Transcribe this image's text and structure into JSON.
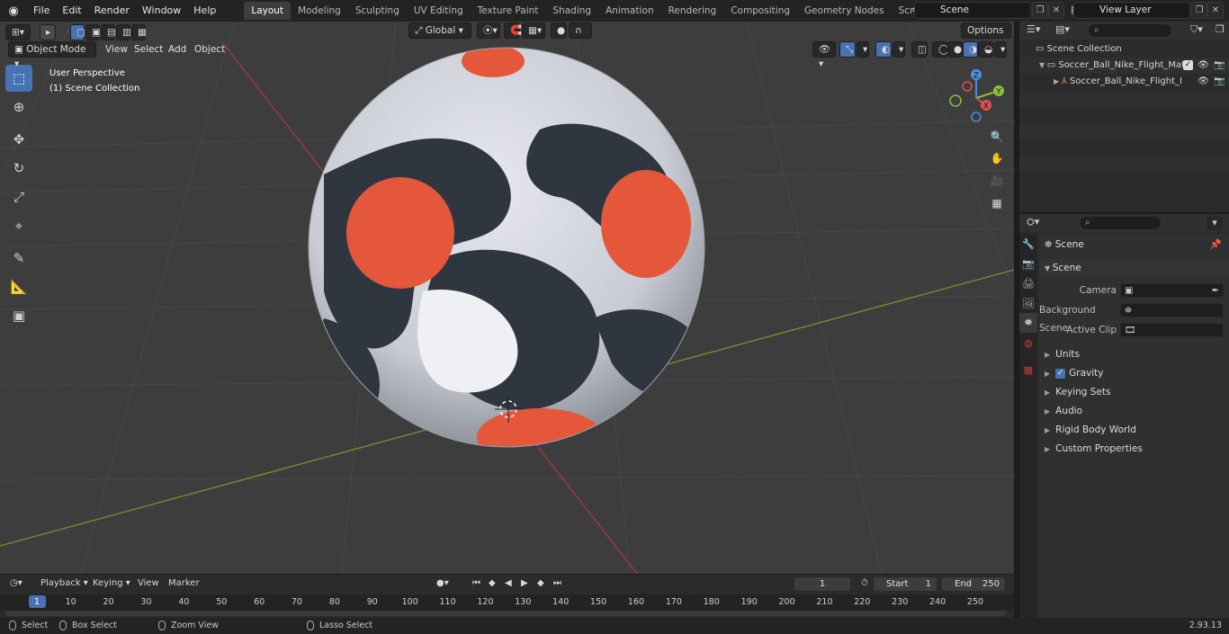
{
  "menu": {
    "items": [
      "File",
      "Edit",
      "Render",
      "Window",
      "Help"
    ],
    "workspace_tabs": [
      "Layout",
      "Modeling",
      "Sculpting",
      "UV Editing",
      "Texture Paint",
      "Shading",
      "Animation",
      "Rendering",
      "Compositing",
      "Geometry Nodes",
      "Scripting"
    ],
    "active_tab": "Layout",
    "scene_value": "Scene",
    "view_layer_value": "View Layer"
  },
  "viewport": {
    "mode": "Object Mode",
    "menus": [
      "View",
      "Select",
      "Add",
      "Object"
    ],
    "transform_orientation": "Global",
    "options_label": "Options",
    "perspective_label": "User Perspective",
    "collection_label": "(1) Scene Collection",
    "gizmo_axes": {
      "x": "X",
      "y": "Y",
      "z": "Z"
    }
  },
  "outliner": {
    "root": "Scene Collection",
    "items": [
      {
        "label": "Soccer_Ball_Nike_Flight_Matc",
        "level": 1
      },
      {
        "label": "Soccer_Ball_Nike_Flight_I",
        "level": 2
      }
    ]
  },
  "properties": {
    "breadcrumb": "Scene",
    "section": "Scene",
    "fields": [
      {
        "label": "Camera"
      },
      {
        "label": "Background Scene"
      },
      {
        "label": "Active Clip"
      }
    ],
    "subpanels": [
      "Units",
      "Gravity",
      "Keying Sets",
      "Audio",
      "Rigid Body World",
      "Custom Properties"
    ],
    "gravity_checked": true
  },
  "timeline": {
    "menus": [
      "Playback",
      "Keying",
      "View",
      "Marker"
    ],
    "current_frame": "1",
    "start_label": "Start",
    "start_value": "1",
    "end_label": "End",
    "end_value": "250",
    "ruler": [
      "1",
      "10",
      "20",
      "30",
      "40",
      "50",
      "60",
      "70",
      "80",
      "90",
      "100",
      "110",
      "120",
      "130",
      "140",
      "150",
      "160",
      "170",
      "180",
      "190",
      "200",
      "210",
      "220",
      "230",
      "240",
      "250"
    ]
  },
  "statusbar": {
    "select": "Select",
    "box_select": "Box Select",
    "zoom_view": "Zoom View",
    "lasso_select": "Lasso Select",
    "version": "2.93.13"
  }
}
